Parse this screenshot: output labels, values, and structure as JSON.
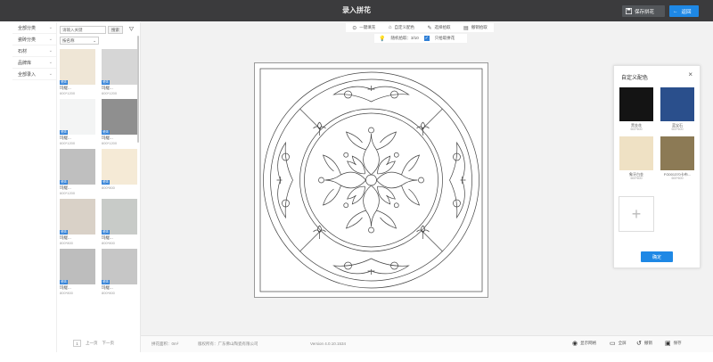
{
  "header": {
    "title": "录入拼花",
    "save_label": "保存拼花",
    "exit_label": "返回"
  },
  "categories": [
    "全部分类",
    "瓷砖分类",
    "石材",
    "品牌库",
    "全部录入"
  ],
  "browser": {
    "search_placeholder": "请输入关键",
    "search_button": "搜索",
    "sort_select": "按名称",
    "tiles": [
      {
        "name": "玛缇...",
        "size": "600*1200",
        "color": "#efe6d6",
        "tag": "瓷砖"
      },
      {
        "name": "玛缇...",
        "size": "600*1200",
        "color": "#d6d6d6",
        "tag": "瓷砖"
      },
      {
        "name": "玛缇...",
        "size": "600*1200",
        "color": "#f3f4f4",
        "tag": "瓷砖"
      },
      {
        "name": "玛缇...",
        "size": "600*1200",
        "color": "#8f8f8f",
        "tag": "瓷砖"
      },
      {
        "name": "玛缇...",
        "size": "600*1200",
        "color": "#bfbfbf",
        "tag": "瓷砖"
      },
      {
        "name": "",
        "size": "800*800",
        "color": "#f5ead6",
        "tag": "瓷砖"
      },
      {
        "name": "玛缇...",
        "size": "800*800",
        "color": "#d9d1c7",
        "tag": "瓷砖"
      },
      {
        "name": "玛缇...",
        "size": "800*800",
        "color": "#c8cbc8",
        "tag": "瓷砖"
      },
      {
        "name": "玛缇...",
        "size": "800*800",
        "color": "#bdbdbd",
        "tag": "瓷砖"
      },
      {
        "name": "玛缇...",
        "size": "800*800",
        "color": "#c6c6c6",
        "tag": "瓷砖"
      }
    ],
    "pager": {
      "current": "1",
      "prev": "上一页",
      "next": "下一页"
    }
  },
  "toolbar": {
    "tools": [
      {
        "label": "一键填充",
        "icon": "fill-icon"
      },
      {
        "label": "自定义配色",
        "icon": "palette-icon"
      },
      {
        "label": "选择拾取",
        "icon": "pick-icon"
      },
      {
        "label": "撤销拾取",
        "icon": "undo-pick-icon"
      }
    ],
    "hint": "随机拾取：3/10",
    "checkbox_label": "只拾取拼花",
    "checkbox_checked": true
  },
  "palette": {
    "title": "自定义配色",
    "items": [
      {
        "name": "黑金花",
        "size": "600*600",
        "color": "#141414"
      },
      {
        "name": "蓝宝石",
        "size": "600*600",
        "color": "#2a4f8c"
      },
      {
        "name": "象牙白金",
        "size": "600*600",
        "color": "#efe1c4"
      },
      {
        "name": "FG001370卡布...",
        "size": "600*600",
        "color": "#8c7a55"
      }
    ],
    "add_label": "+",
    "confirm_label": "确定"
  },
  "statusbar": {
    "area_label": "拼花面积：0m²",
    "company": "版权所有：广东佛山陶瓷有限公司",
    "version": "Version 4.0.10.1534",
    "actions": [
      {
        "label": "显示网格",
        "icon": "grid-icon"
      },
      {
        "label": "全屏",
        "icon": "monitor-icon"
      },
      {
        "label": "撤销",
        "icon": "undo-icon"
      },
      {
        "label": "保存",
        "icon": "save-icon"
      }
    ]
  },
  "colors": {
    "topbar": "#3b3b3d",
    "accent": "#1e88e5",
    "workspace": "#f2f2f2"
  }
}
